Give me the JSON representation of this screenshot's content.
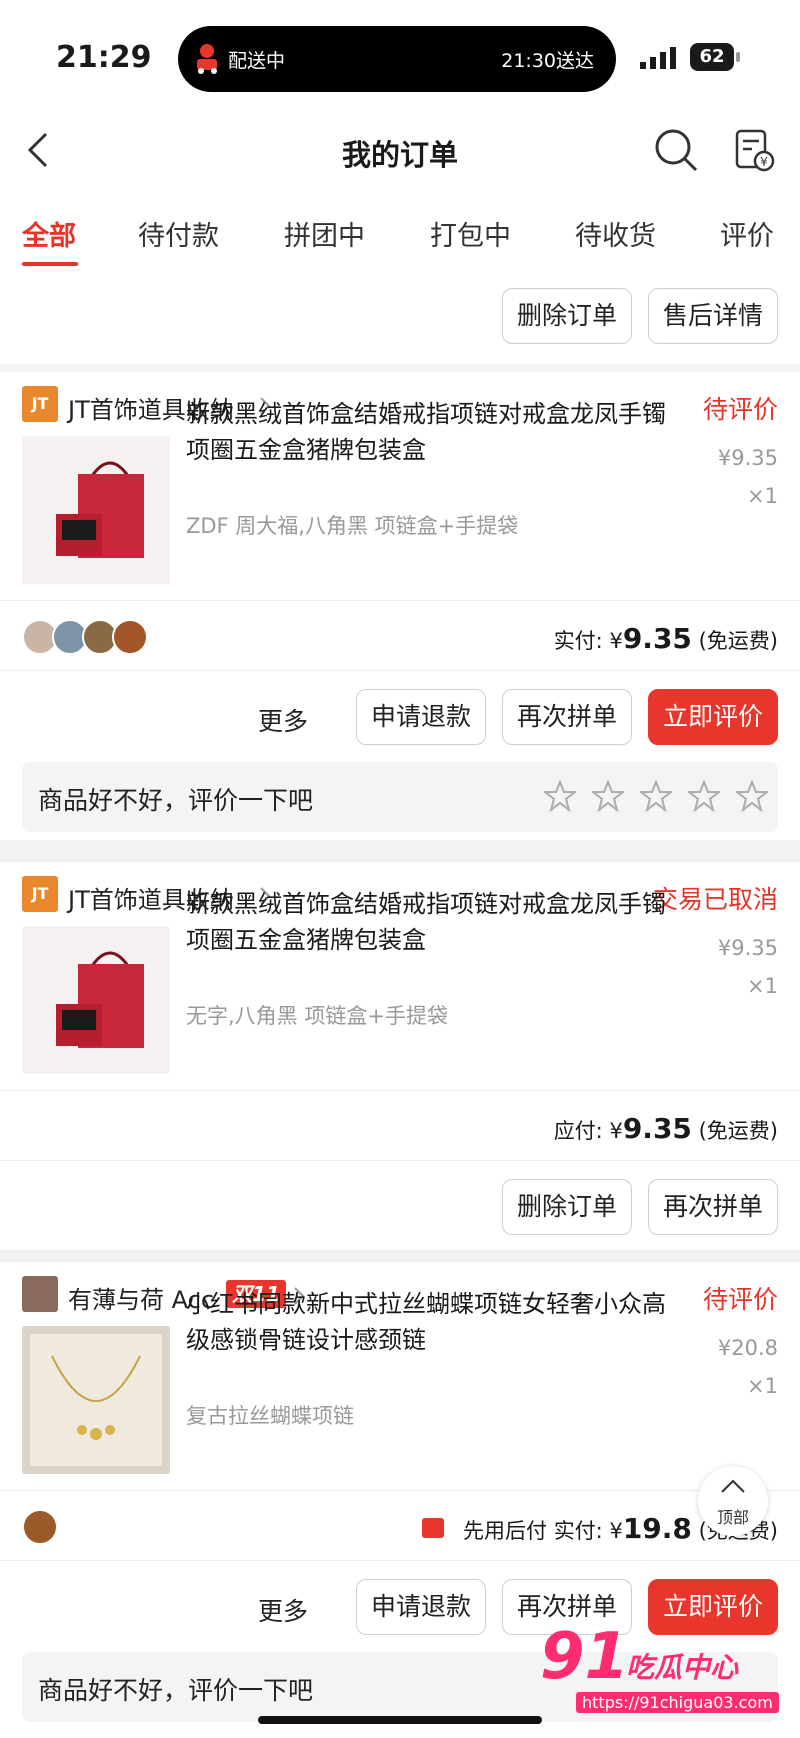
{
  "status_bar": {
    "time": "21:29",
    "island_label": "配送中",
    "island_eta": "21:30送达",
    "battery": "62"
  },
  "header": {
    "title": "我的订单"
  },
  "tabs": [
    "全部",
    "待付款",
    "拼团中",
    "打包中",
    "待收货",
    "评价"
  ],
  "top_actions": {
    "delete": "删除订单",
    "after_sales": "售后详情"
  },
  "orders": [
    {
      "shop_logo": "JT",
      "shop": "JT首饰道具收纳",
      "status": "待评价",
      "product_name": "新款黑绒首饰盒结婚戒指项链对戒盒龙凤手镯项圈五金盒猪牌包装盒",
      "spec": "ZDF 周大福,八角黑 项链盒+手提袋",
      "price": "¥9.35",
      "qty": "×1",
      "paid_label": "实付:",
      "paid_currency": "¥",
      "paid_amount": "9.35",
      "shipping": "(免运费)",
      "btn_more": "更多",
      "btn_refund": "申请退款",
      "btn_rebuy": "再次拼单",
      "btn_review": "立即评价",
      "rate_prompt": "商品好不好，评价一下吧"
    },
    {
      "shop_logo": "JT",
      "shop": "JT首饰道具收纳",
      "status": "交易已取消",
      "product_name": "新款黑绒首饰盒结婚戒指项链对戒盒龙凤手镯项圈五金盒猪牌包装盒",
      "spec": "无字,八角黑 项链盒+手提袋",
      "price": "¥9.35",
      "qty": "×1",
      "paid_label": "应付:",
      "paid_currency": "¥",
      "paid_amount": "9.35",
      "shipping": "(免运费)",
      "btn_delete": "删除订单",
      "btn_rebuy": "再次拼单"
    },
    {
      "shop": "有薄与荷 Acc",
      "promo": "双11",
      "status": "待评价",
      "product_name": "小红书同款新中式拉丝蝴蝶项链女轻奢小众高级感锁骨链设计感颈链",
      "spec": "复古拉丝蝴蝶项链",
      "price": "¥20.8",
      "qty": "×1",
      "bnpl": "先用后付",
      "paid_label": "实付:",
      "paid_currency": "¥",
      "paid_amount": "19.8",
      "shipping": "(免运费)",
      "btn_more": "更多",
      "btn_refund": "申请退款",
      "btn_rebuy": "再次拼单",
      "btn_review": "立即评价",
      "rate_prompt": "商品好不好，评价一下吧"
    }
  ],
  "back_to_top": "顶部",
  "watermark": {
    "num": "91",
    "name": "吃瓜中心",
    "url": "https://91chigua03.com"
  },
  "colors": {
    "accent": "#e63428",
    "button_red": "#e9362c",
    "muted": "#999999"
  }
}
